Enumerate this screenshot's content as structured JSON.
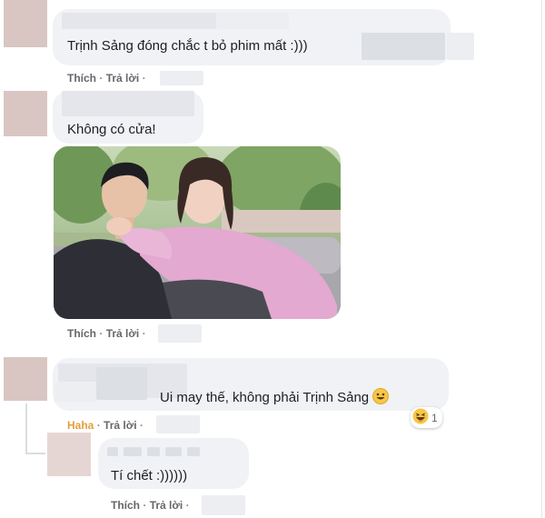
{
  "comments": [
    {
      "text": "Trịnh Sảng đóng chắc t bỏ phim mất :)))",
      "actions": {
        "like": "Thích",
        "reply": "Trả lời"
      }
    },
    {
      "text": "Không có cửa!",
      "actions": {
        "like": "Thích",
        "reply": "Trả lời"
      },
      "photo": "drama-still-couple-photo"
    },
    {
      "text": "Ui may thế, không phải Trịnh Sảng",
      "emoji": "grinning-face-icon",
      "actions": {
        "reaction_label": "Haha",
        "reply": "Trả lời"
      },
      "reaction": {
        "icon": "haha-icon",
        "count": "1"
      }
    }
  ],
  "reply": {
    "text": "Tí chết :))))))",
    "actions": {
      "like": "Thích",
      "reply": "Trả lời"
    }
  },
  "colors": {
    "bubble": "#f0f2f5",
    "action_text": "#65676b",
    "haha": "#e2a03f",
    "text": "#050505"
  }
}
